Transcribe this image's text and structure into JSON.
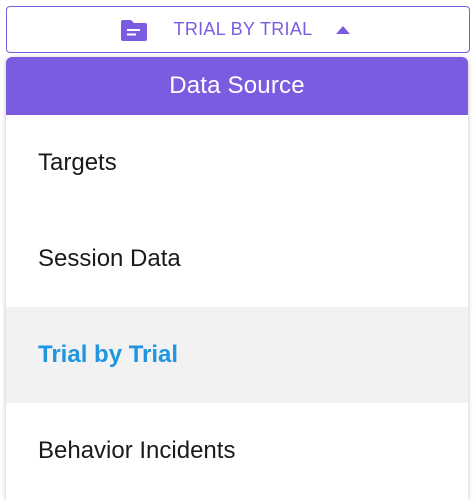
{
  "selector": {
    "label": "TRIAL BY TRIAL",
    "icon": "folder-icon",
    "caret_icon": "caret-up-icon"
  },
  "dropdown": {
    "header": "Data Source",
    "items": [
      {
        "label": "Targets",
        "selected": false
      },
      {
        "label": "Session Data",
        "selected": false
      },
      {
        "label": "Trial by Trial",
        "selected": true
      },
      {
        "label": "Behavior Incidents",
        "selected": false
      }
    ]
  },
  "colors": {
    "accent": "#7b5ce0",
    "selected_text": "#2196e0",
    "selected_bg": "#f2f2f2"
  }
}
